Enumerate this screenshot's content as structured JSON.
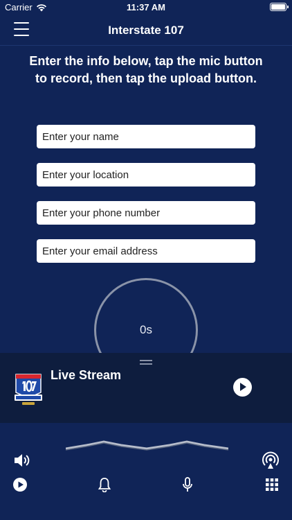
{
  "status_bar": {
    "carrier": "Carrier",
    "time": "11:37 AM"
  },
  "nav": {
    "title": "Interstate 107"
  },
  "instructions": "Enter the info below, tap the mic button to record, then tap the upload button.",
  "form": {
    "name_placeholder": "Enter your name",
    "location_placeholder": "Enter your location",
    "phone_placeholder": "Enter your phone number",
    "email_placeholder": "Enter your email address"
  },
  "recorder": {
    "elapsed": "0s"
  },
  "player": {
    "title": "Live Stream"
  },
  "icons": {
    "menu": "menu-icon",
    "volume": "volume-icon",
    "broadcast": "broadcast-icon",
    "play": "play-icon",
    "bell": "bell-icon",
    "mic": "mic-icon",
    "grid": "grid-icon"
  },
  "colors": {
    "background": "#102457",
    "panel": "#0e1d3e"
  }
}
